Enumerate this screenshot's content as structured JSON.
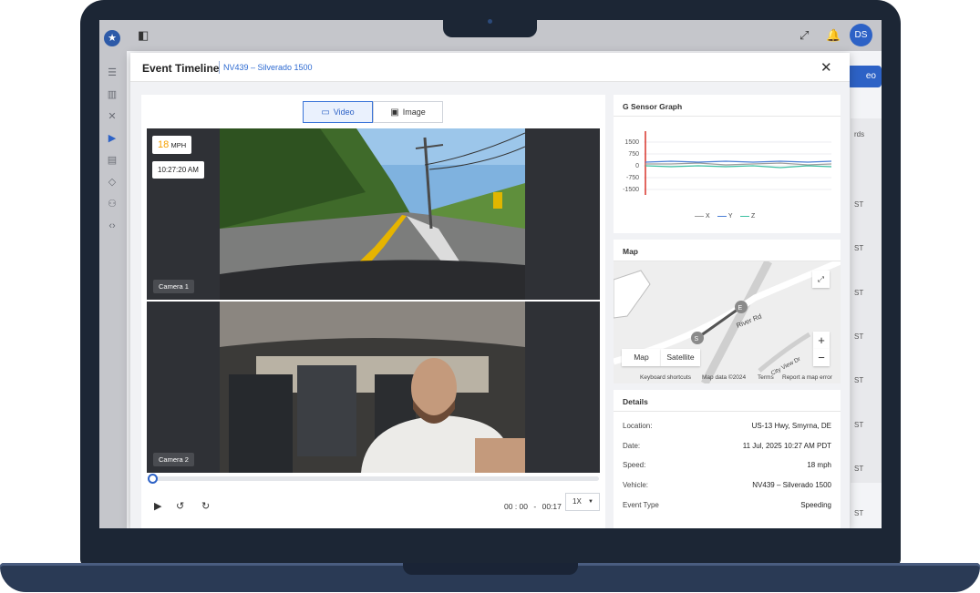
{
  "topbar": {
    "avatar_initials": "DS",
    "button_fragment": "eo"
  },
  "background_list": {
    "header_fragment": "rds",
    "row_fragment": "ST"
  },
  "modal": {
    "title": "Event Timeline",
    "subtitle": "NV439 – Silverado 1500",
    "close_symbol": "✕"
  },
  "media_tabs": [
    {
      "label": "Video",
      "active": true
    },
    {
      "label": "Image",
      "active": false
    }
  ],
  "speed_overlay": {
    "value": "18",
    "unit": "MPH",
    "color": "#f5a000"
  },
  "time_overlay": "10:27:20 AM",
  "cameras": [
    {
      "label": "Camera 1"
    },
    {
      "label": "Camera 2"
    }
  ],
  "playback": {
    "current": "00 : 00",
    "separator": "-",
    "total": "00:17",
    "speed": "1X",
    "progress": 0.0
  },
  "g_sensor": {
    "title": "G Sensor Graph",
    "y_ticks": [
      "1500",
      "750",
      "0",
      "-750",
      "-1500"
    ],
    "legend": [
      {
        "name": "X",
        "color": "#9e9e9e"
      },
      {
        "name": "Y",
        "color": "#4a7fd6"
      },
      {
        "name": "Z",
        "color": "#3cc0a0"
      }
    ],
    "event_marker_color": "#d9342b"
  },
  "map": {
    "title": "Map",
    "type_buttons": [
      "Map",
      "Satellite"
    ],
    "zoom_in": "+",
    "zoom_out": "−",
    "markers": [
      "S",
      "E"
    ],
    "roads": [
      "River Rd",
      "City View Dr"
    ],
    "attribution": [
      "Keyboard shortcuts",
      "Map data ©2024",
      "Terms",
      "Report a map error"
    ]
  },
  "details": {
    "title": "Details",
    "rows": [
      {
        "label": "Location:",
        "value": "US-13 Hwy, Smyrna, DE"
      },
      {
        "label": "Date:",
        "value": "11 Jul, 2025 10:27 AM PDT"
      },
      {
        "label": "Speed:",
        "value": "18 mph"
      },
      {
        "label": "Vehicle:",
        "value": "NV439 – Silverado 1500"
      },
      {
        "label": "Event Type",
        "value": "Speeding"
      }
    ]
  }
}
